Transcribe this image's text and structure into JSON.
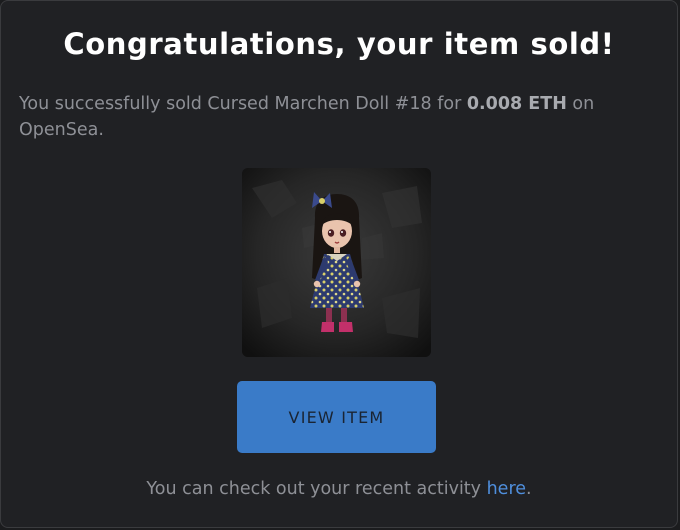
{
  "dialog": {
    "title": "Congratulations, your item sold!",
    "message_prefix": "You successfully sold Cursed Marchen Doll #18 for ",
    "amount": "0.008 ETH",
    "message_suffix": " on OpenSea.",
    "nft_image": "cursed-marchen-doll-18",
    "button_label": "VIEW ITEM",
    "footer_prefix": "You can check out your recent activity ",
    "footer_link": "here",
    "footer_suffix": "."
  },
  "colors": {
    "background": "#202124",
    "accent": "#3a7bc8",
    "link": "#4f8fdd",
    "muted_text": "#8e9096"
  }
}
